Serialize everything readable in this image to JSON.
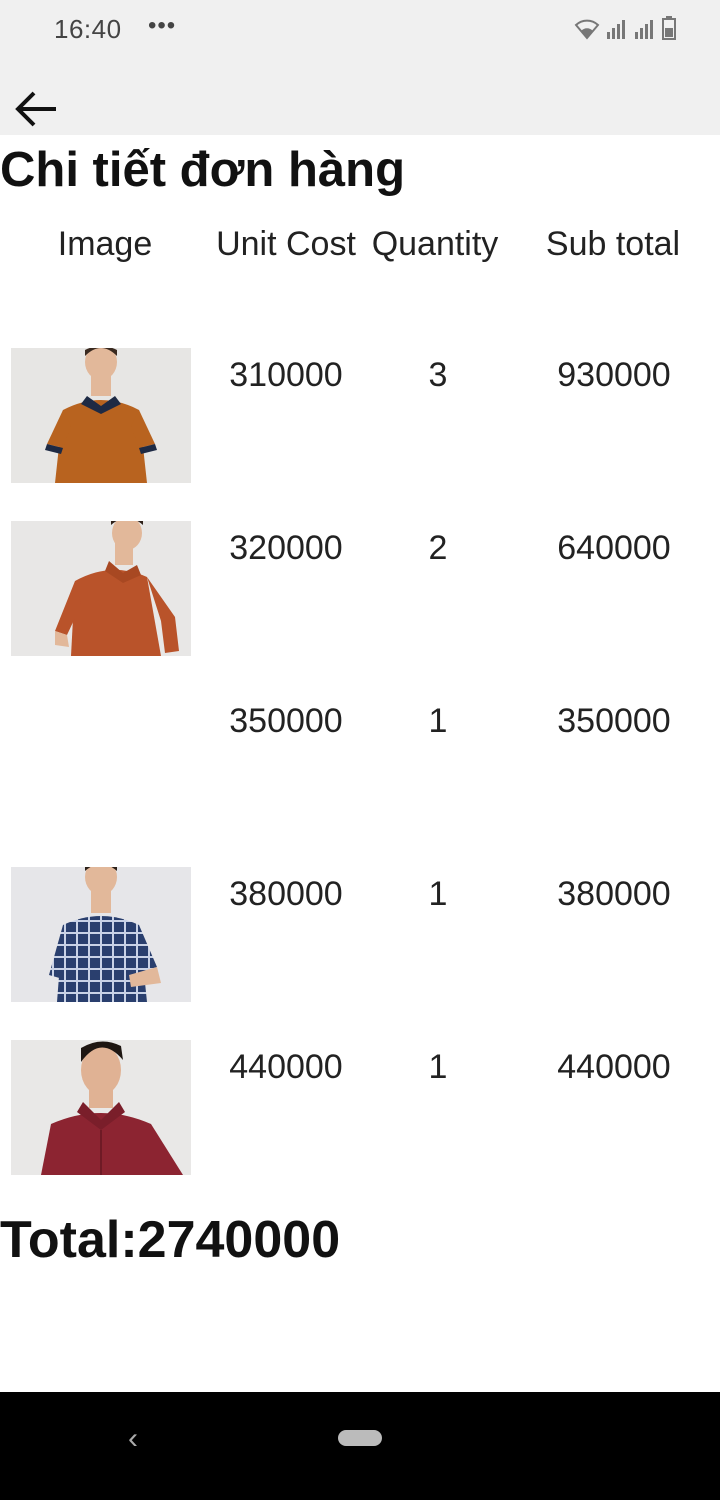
{
  "status_bar": {
    "time": "16:40",
    "more": "•••",
    "icons": [
      "wifi-icon",
      "signal-icon",
      "signal-icon",
      "battery-icon"
    ]
  },
  "app_bar": {
    "back_icon": "arrow-left-icon"
  },
  "page": {
    "title": "Chi tiết đơn hàng"
  },
  "table": {
    "headers": {
      "image": "Image",
      "unit_cost": "Unit Cost",
      "quantity": "Quantity",
      "sub_total": "Sub total"
    },
    "rows": [
      {
        "image": "orange-polo-navy-collar",
        "unit_cost": "310000",
        "quantity": "3",
        "sub_total": "930000"
      },
      {
        "image": "orange-polo",
        "unit_cost": "320000",
        "quantity": "2",
        "sub_total": "640000"
      },
      {
        "image": "",
        "unit_cost": "350000",
        "quantity": "1",
        "sub_total": "350000"
      },
      {
        "image": "blue-plaid-shirt",
        "unit_cost": "380000",
        "quantity": "1",
        "sub_total": "380000"
      },
      {
        "image": "maroon-shirt",
        "unit_cost": "440000",
        "quantity": "1",
        "sub_total": "440000"
      }
    ]
  },
  "total": {
    "label": "Total:",
    "value": "2740000"
  },
  "nav_bar": {
    "back": "‹"
  }
}
